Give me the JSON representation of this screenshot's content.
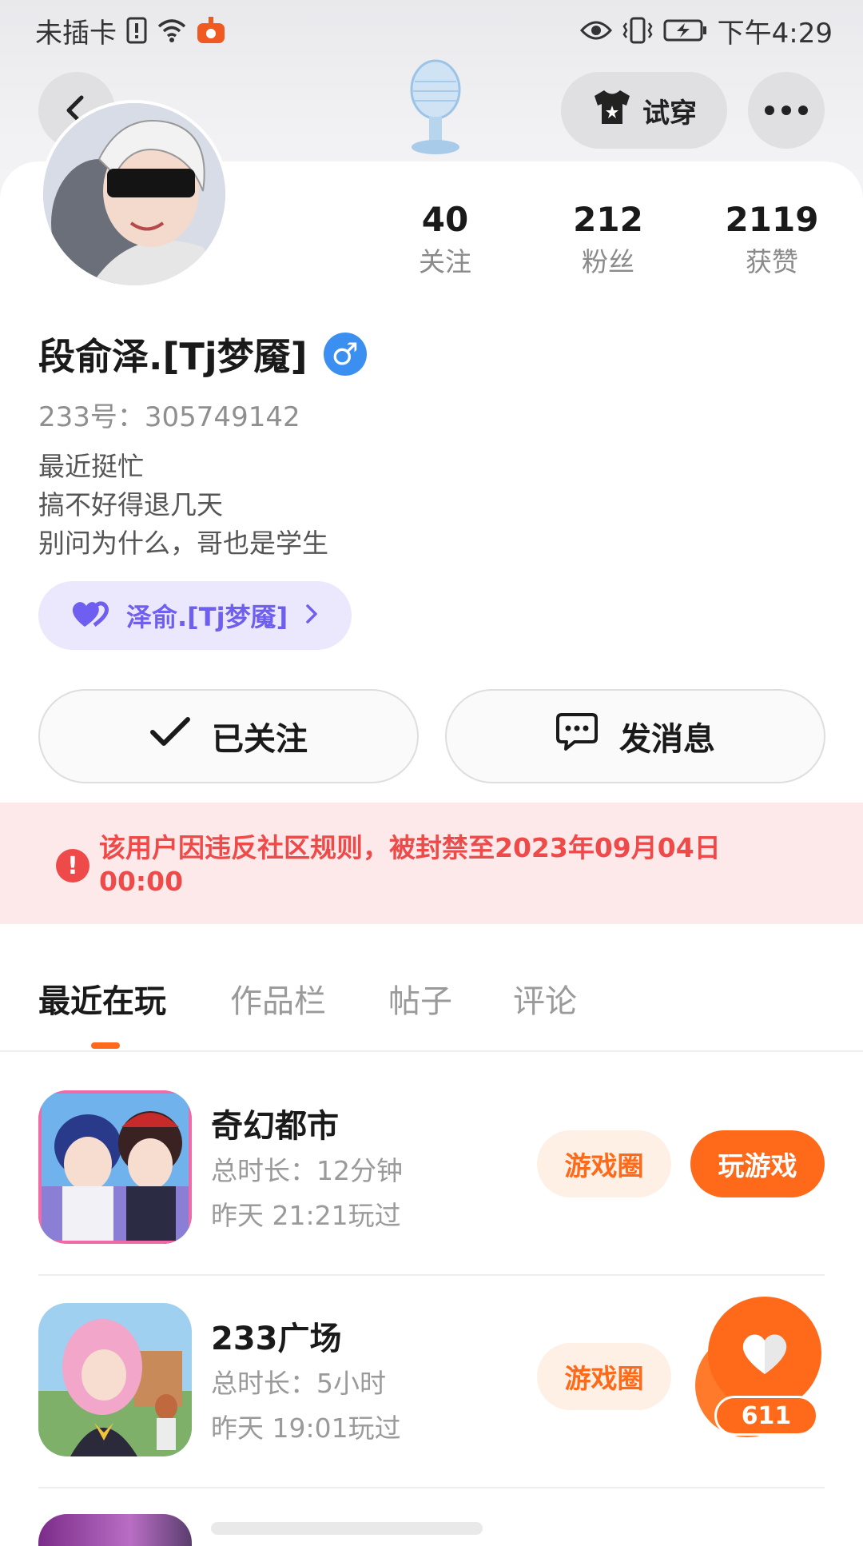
{
  "status_bar": {
    "carrier": "未插卡",
    "time": "下午4:29"
  },
  "header": {
    "try_on_label": "试穿"
  },
  "profile": {
    "username": "段俞泽.[Tj梦魇]",
    "gender_symbol": "♂",
    "uid_label": "233号：",
    "uid_value": "305749142",
    "bio": [
      "最近挺忙",
      "搞不好得退几天",
      "别问为什么，哥也是学生"
    ],
    "family_name": "泽俞.[Tj梦魇]",
    "stats": [
      {
        "value": "40",
        "label": "关注"
      },
      {
        "value": "212",
        "label": "粉丝"
      },
      {
        "value": "2119",
        "label": "获赞"
      }
    ]
  },
  "actions": {
    "follow_label": "已关注",
    "message_label": "发消息"
  },
  "ban_notice": "该用户因违反社区规则，被封禁至2023年09月04日 00:00",
  "tabs": [
    "最近在玩",
    "作品栏",
    "帖子",
    "评论"
  ],
  "games": [
    {
      "title": "奇幻都市",
      "duration": "总时长：12分钟",
      "last_played": "昨天 21:21玩过",
      "circle_label": "游戏圈",
      "play_label": "玩游戏"
    },
    {
      "title": "233广场",
      "duration": "总时长：5小时",
      "last_played": "昨天 19:01玩过",
      "circle_label": "游戏圈"
    }
  ],
  "floating_like": {
    "count": "611"
  },
  "colors": {
    "accent": "#ff6a1a",
    "ban_text": "#ef4a4a",
    "ban_bg": "#fde9e9",
    "gender_blue": "#3b8ff0",
    "family_purple": "#6f5ff0"
  }
}
